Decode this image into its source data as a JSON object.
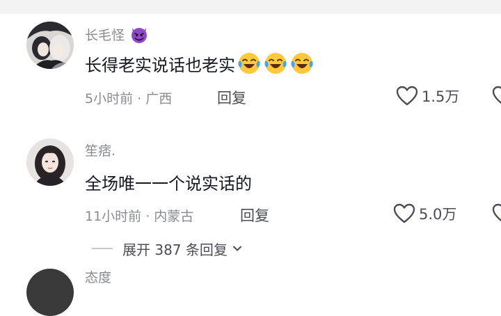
{
  "comments": [
    {
      "username": "长毛怪",
      "username_badge_icon": "smiling-devil-emoji",
      "content": "长得老实说话也老实",
      "content_emojis": [
        "laughing-crying-emoji",
        "laughing-crying-emoji",
        "laughing-crying-emoji"
      ],
      "time_location": "5小时前 · 广西",
      "reply_label": "回复",
      "like_icon": "heart-outline-icon",
      "like_count": "1.5万"
    },
    {
      "username": "笙痞.",
      "content": "全场唯一一个说实话的",
      "time_location": "11小时前 · 内蒙古",
      "reply_label": "回复",
      "like_icon": "heart-outline-icon",
      "like_count": "5.0万",
      "expand_replies": "展开 387 条回复",
      "expand_icon": "chevron-down-icon"
    },
    {
      "username": "态度"
    }
  ],
  "colors": {
    "primary_text": "#161823",
    "secondary_text": "#8a8b91",
    "action_text": "#4b4c55",
    "background": "#ffffff"
  }
}
